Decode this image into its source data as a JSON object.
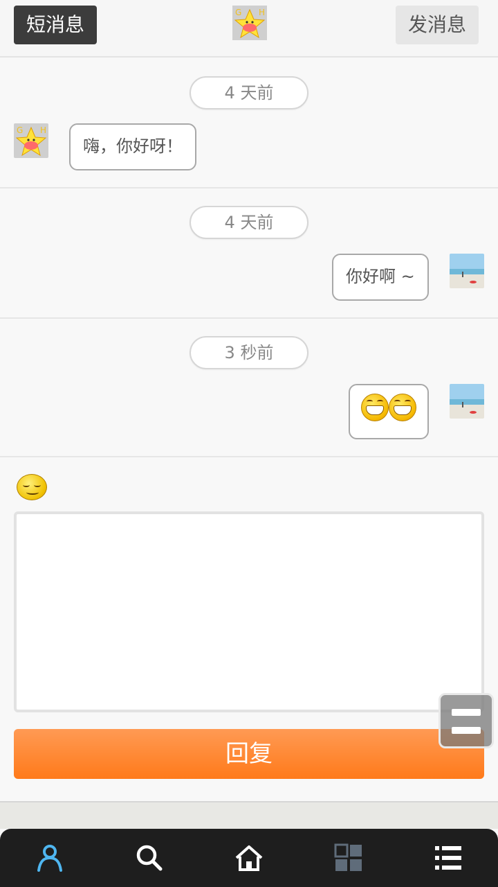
{
  "header": {
    "left_button": "短消息",
    "right_button": "发消息",
    "logo_icon": "star-logo-icon"
  },
  "messages": [
    {
      "time": "4 天前",
      "text": "嗨，你好呀！",
      "side": "left",
      "avatar_icon": "star-avatar-icon"
    },
    {
      "time": "4 天前",
      "text": "你好啊 ~",
      "side": "right",
      "avatar_icon": "beach-avatar-icon"
    },
    {
      "time": "3 秒前",
      "text": "",
      "side": "right",
      "avatar_icon": "beach-avatar-icon",
      "emoji": [
        "grin-emoji-icon",
        "grin-emoji-icon"
      ]
    }
  ],
  "reply": {
    "emoji_picker_icon": "smile-icon",
    "input_value": "",
    "button_label": "回复"
  },
  "colors": {
    "reply_button": "#ff7a1a",
    "header_left_button": "#3c3c3c",
    "nav_active": "#4fb6f0"
  },
  "bottom_nav": [
    {
      "icon": "user-icon",
      "active": true
    },
    {
      "icon": "search-icon",
      "active": false
    },
    {
      "icon": "home-icon",
      "active": false
    },
    {
      "icon": "grid-icon",
      "active": false
    },
    {
      "icon": "menu-list-icon",
      "active": false
    }
  ]
}
